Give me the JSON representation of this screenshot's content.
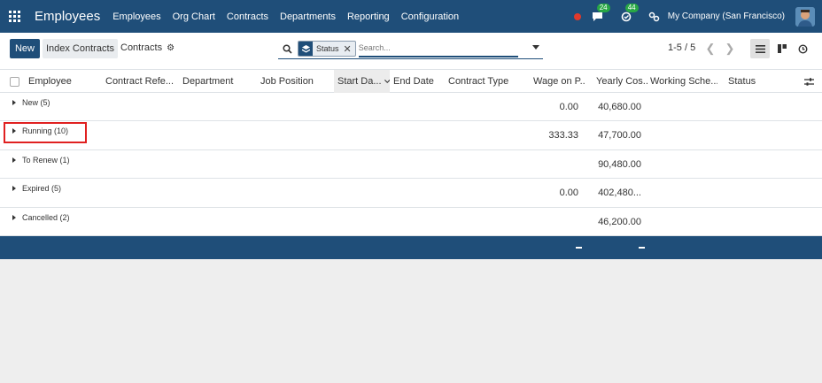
{
  "navbar": {
    "brand": "Employees",
    "menu": [
      "Employees",
      "Org Chart",
      "Contracts",
      "Departments",
      "Reporting",
      "Configuration"
    ],
    "messages_badge": "24",
    "activities_badge": "44",
    "company": "My Company (San Francisco)"
  },
  "control_panel": {
    "new_label": "New",
    "index_label": "Index Contracts",
    "breadcrumb": "Contracts",
    "facet_label": "Status",
    "search_placeholder": "Search...",
    "pager": "1-5 / 5"
  },
  "table": {
    "columns": [
      "Employee",
      "Contract Refe...",
      "Department",
      "Job Position",
      "Start Da...",
      "End Date",
      "Contract Type",
      "Wage on P...",
      "Yearly Cos...",
      "Working Sche...",
      "Status"
    ],
    "groups": [
      {
        "label": "New (5)",
        "wage": "0.00",
        "yearly": "40,680.00"
      },
      {
        "label": "Running (10)",
        "wage": "333.33",
        "yearly": "47,700.00"
      },
      {
        "label": "To Renew (1)",
        "wage": "",
        "yearly": "90,480.00"
      },
      {
        "label": "Expired (5)",
        "wage": "0.00",
        "yearly": "402,480..."
      },
      {
        "label": "Cancelled (2)",
        "wage": "",
        "yearly": "46,200.00"
      }
    ],
    "footer_wage": "–",
    "footer_yearly": "–"
  },
  "colors": {
    "brand": "#1f4e79",
    "highlight": "#e02020",
    "badge": "#28a745",
    "notification_dot": "#e0392b"
  }
}
